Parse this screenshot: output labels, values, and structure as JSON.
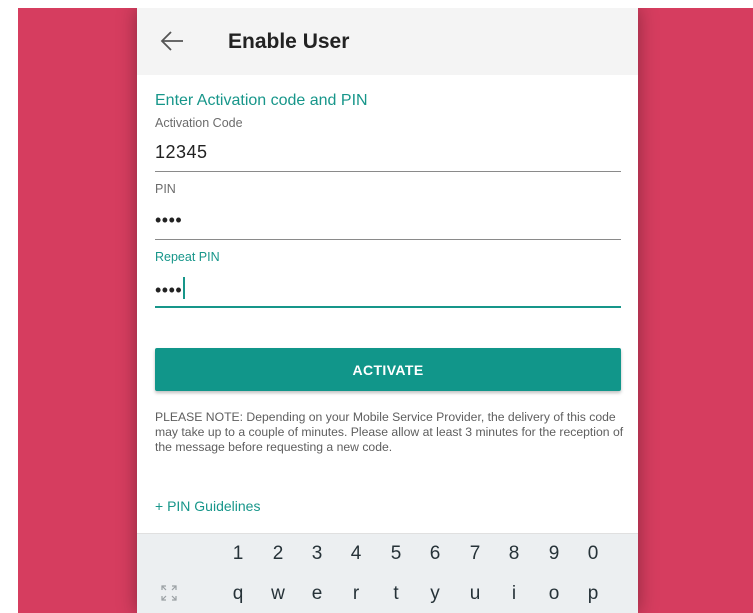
{
  "appbar": {
    "title": "Enable User",
    "back_icon": "arrow-left-icon"
  },
  "form": {
    "section_title": "Enter Activation code and PIN",
    "activation_label": "Activation Code",
    "activation_value": "12345",
    "pin_label": "PIN",
    "pin_value": "••••",
    "repeat_pin_label": "Repeat PIN",
    "repeat_pin_value": "••••"
  },
  "activate_button": "ACTIVATE",
  "note": "PLEASE NOTE: Depending on your Mobile Service Provider, the delivery of this code may take up to a couple of minutes. Please allow at least 3 minutes for the reception of the message before requesting a new code.",
  "pin_guidelines_link": "+ PIN Guidelines",
  "keyboard": {
    "number_row": [
      "1",
      "2",
      "3",
      "4",
      "5",
      "6",
      "7",
      "8",
      "9",
      "0"
    ],
    "letter_row": [
      "q",
      "w",
      "e",
      "r",
      "t",
      "y",
      "u",
      "i",
      "o",
      "p"
    ],
    "expand_icon": "expand-arrows-icon"
  },
  "colors": {
    "accent": "#17968a",
    "background": "#d63d5f",
    "button": "#11968a"
  }
}
